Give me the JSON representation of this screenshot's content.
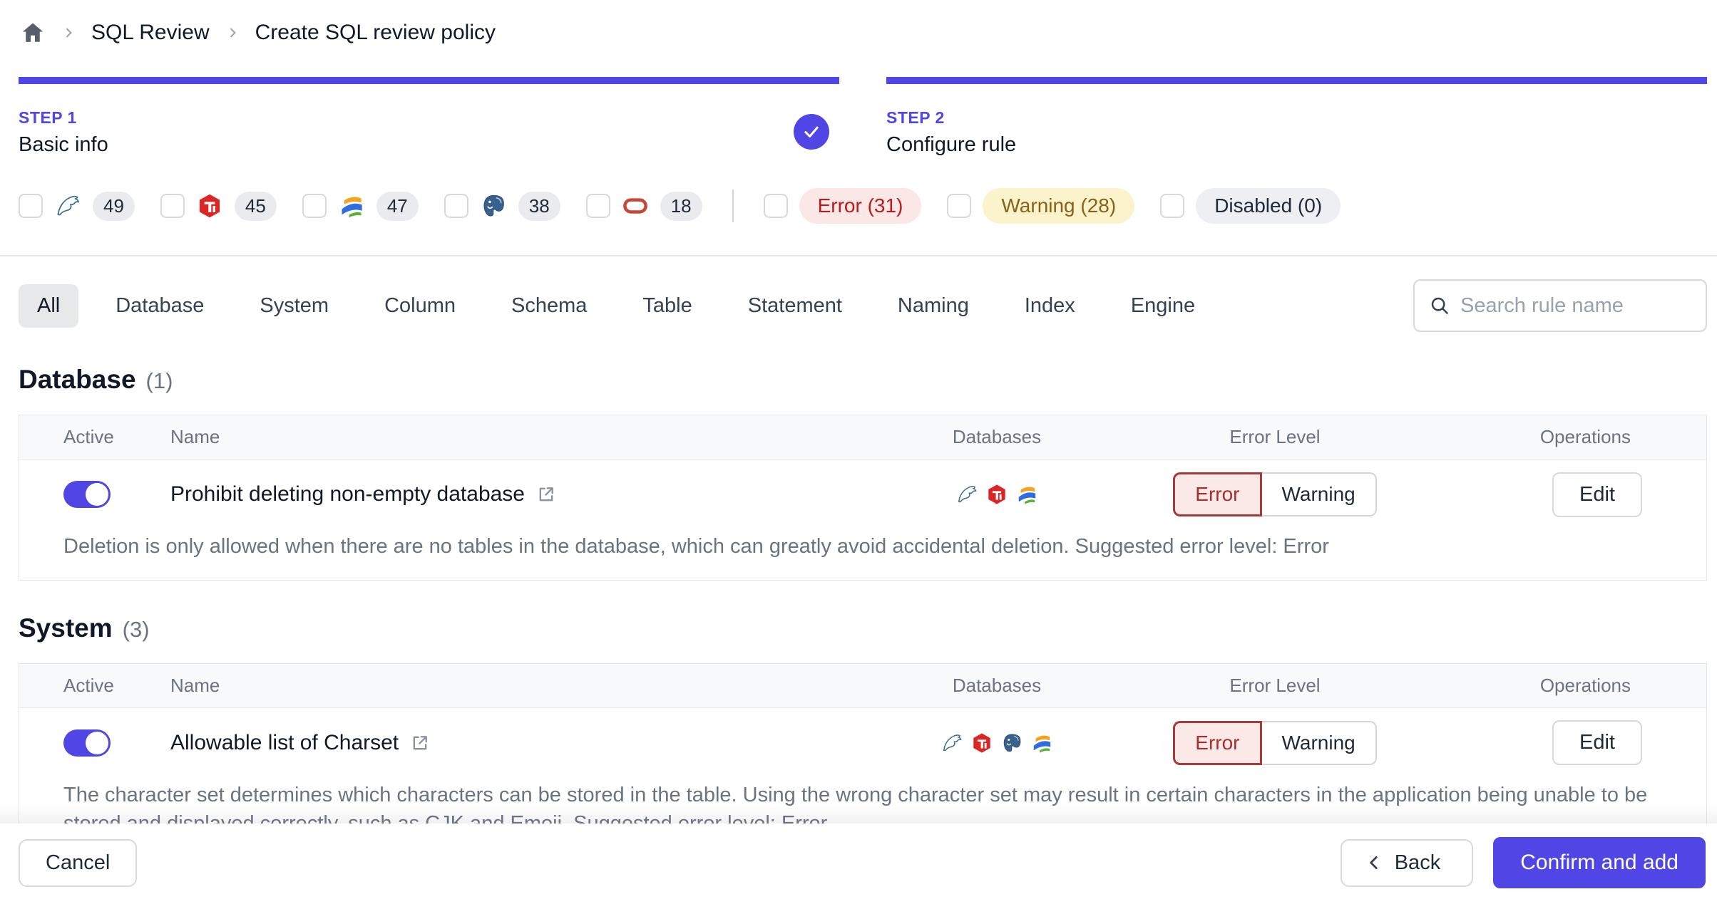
{
  "breadcrumb": {
    "items": [
      "SQL Review",
      "Create SQL review policy"
    ]
  },
  "steps": [
    {
      "label": "STEP 1",
      "title": "Basic info",
      "completed": true
    },
    {
      "label": "STEP 2",
      "title": "Configure rule",
      "completed": false
    }
  ],
  "engine_filters": [
    {
      "engine": "mysql",
      "count": "49"
    },
    {
      "engine": "tidb",
      "count": "45"
    },
    {
      "engine": "oceanbase",
      "count": "47"
    },
    {
      "engine": "postgresql",
      "count": "38"
    },
    {
      "engine": "oracle",
      "count": "18"
    }
  ],
  "level_filters": [
    {
      "label": "Error (31)",
      "type": "error"
    },
    {
      "label": "Warning (28)",
      "type": "warning"
    },
    {
      "label": "Disabled (0)",
      "type": "disabled"
    }
  ],
  "tabs": [
    "All",
    "Database",
    "System",
    "Column",
    "Schema",
    "Table",
    "Statement",
    "Naming",
    "Index",
    "Engine"
  ],
  "search": {
    "placeholder": "Search rule name"
  },
  "table": {
    "headers": [
      "Active",
      "Name",
      "Databases",
      "Error Level",
      "Operations"
    ]
  },
  "sections": [
    {
      "title": "Database",
      "count": "(1)",
      "rows": [
        {
          "name": "Prohibit deleting non-empty database",
          "active": true,
          "engines": [
            "mysql",
            "tidb",
            "oceanbase"
          ],
          "level_error": "Error",
          "level_warning": "Warning",
          "operation": "Edit",
          "description": "Deletion is only allowed when there are no tables in the database, which can greatly avoid accidental deletion. Suggested error level: Error"
        }
      ]
    },
    {
      "title": "System",
      "count": "(3)",
      "rows": [
        {
          "name": "Allowable list of Charset",
          "active": true,
          "engines": [
            "mysql",
            "tidb",
            "postgresql",
            "oceanbase"
          ],
          "level_error": "Error",
          "level_warning": "Warning",
          "operation": "Edit",
          "description": "The character set determines which characters can be stored in the table. Using the wrong character set may result in certain characters in the application being unable to be stored and displayed correctly, such as CJK and Emoji. Suggested error level: Error"
        }
      ]
    }
  ],
  "footer": {
    "cancel_label": "Cancel",
    "back_label": "Back",
    "confirm_label": "Confirm and add"
  },
  "colors": {
    "accent_indigo": "#4f46e5",
    "error_red": "#b91c1c",
    "error_bg": "#fbe7e6",
    "warning_text": "#8a6116",
    "warning_bg": "#fbf3cc",
    "disabled_bg": "#edeff2"
  }
}
